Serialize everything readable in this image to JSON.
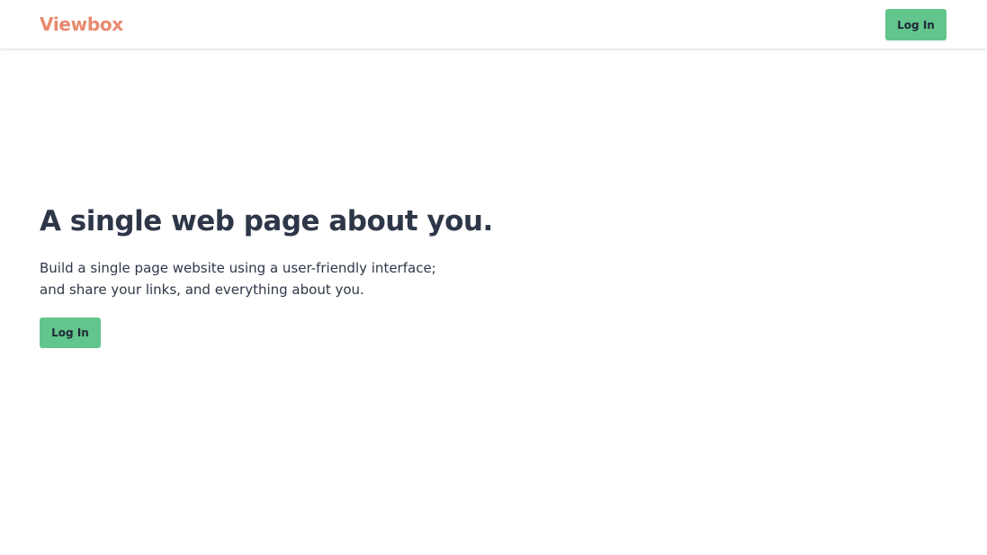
{
  "header": {
    "brand": "Viewbox",
    "login_label": "Log In"
  },
  "hero": {
    "title": "A single web page about you.",
    "description_line1": "Build a single page website using a user-friendly interface;",
    "description_line2": "and share your links, and everything about you.",
    "login_label": "Log In"
  },
  "colors": {
    "brand": "#e8896e",
    "button": "#62c58c",
    "heading": "#2e3748"
  }
}
